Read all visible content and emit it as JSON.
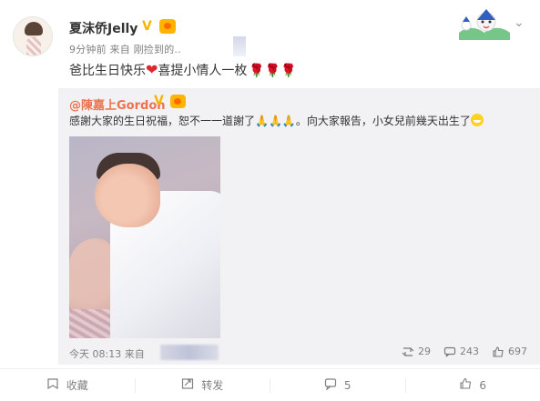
{
  "post": {
    "author": "夏沫侨Jelly",
    "verified_symbol": "V",
    "meta": "9分钟前 来自 刚捡到的..",
    "text": "爸比生日快乐",
    "heart": "❤",
    "text2": "喜提小情人一枚",
    "roses": "🌹🌹🌹"
  },
  "repost": {
    "author": "@陳嘉上Gordon",
    "verified_symbol": "V",
    "text_part1": "感謝大家的生日祝福，恕不一一道謝了",
    "pray_emoji": "🙏🙏🙏",
    "text_part2": "。向大家報告，小女兒前幾天出生了",
    "time": "今天 08:13 来自",
    "stats": {
      "repost_count": "29",
      "comment_count": "243",
      "like_count": "697"
    }
  },
  "actions": {
    "favorite_label": "收藏",
    "repost_label": "转发",
    "comment_label": "5",
    "like_label": "6"
  },
  "icons": {
    "favorite": "favorite-icon",
    "repost": "repost-icon",
    "comment": "comment-icon",
    "like": "like-icon",
    "chevron": "chevron-down-icon"
  },
  "colors": {
    "accent_orange": "#eb7350",
    "badge_gold": "#f7b500",
    "heart_red": "#e0262f",
    "rose_red": "#c81d2a",
    "repost_bg": "#f2f2f5"
  }
}
